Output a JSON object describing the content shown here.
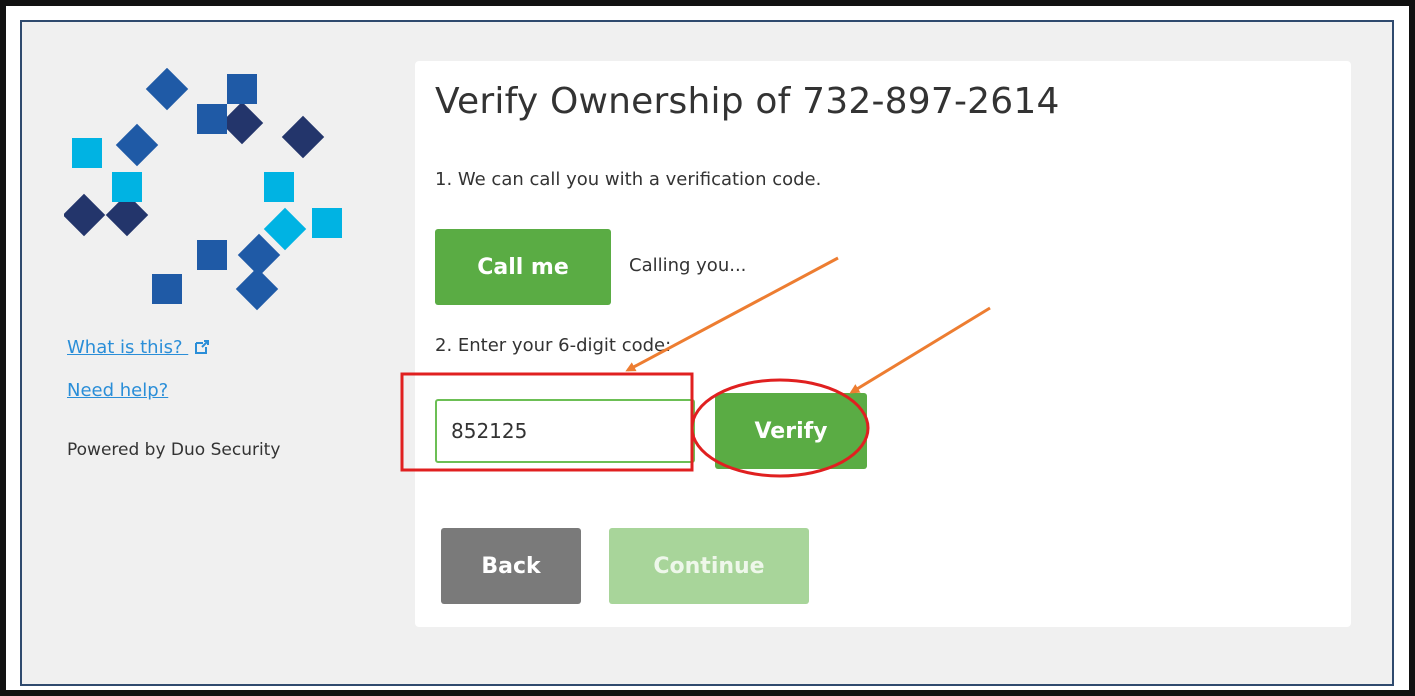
{
  "sidebar": {
    "links": [
      {
        "label": "What is this?",
        "icon": "external-link-icon"
      },
      {
        "label": "Need help?"
      }
    ],
    "powered_by": "Powered by Duo Security",
    "logo": {
      "icon": "duo-logo-icon",
      "colors": {
        "dark": "#23356b",
        "mid": "#1f5aa6",
        "light": "#00b3e3"
      }
    }
  },
  "main": {
    "title": "Verify Ownership of 732-897-2614",
    "step1": "1. We can call you with a verification code.",
    "call_button": "Call me",
    "call_status": "Calling you...",
    "step2": "2. Enter your 6-digit code:",
    "code_input_value": "852125",
    "verify_button": "Verify",
    "back_button": "Back",
    "continue_button": "Continue"
  },
  "colors": {
    "accent_green": "#5aac44",
    "disabled_green": "#a8d59a",
    "back_gray": "#7a7a7a",
    "link_blue": "#2a8ed8",
    "annotation_red": "#e02020",
    "annotation_orange": "#ed7d31"
  }
}
